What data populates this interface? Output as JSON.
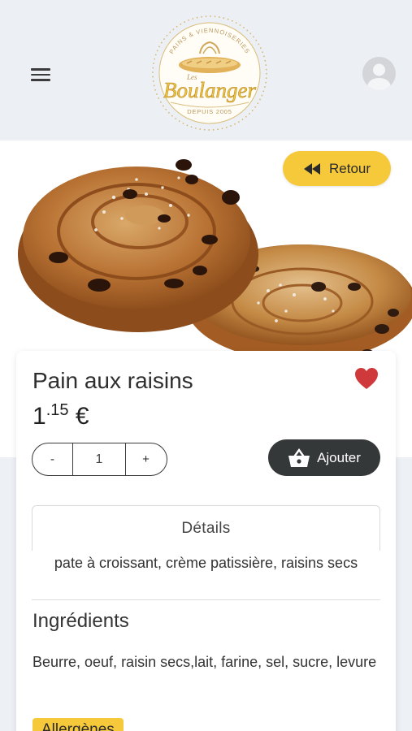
{
  "header": {
    "menu_icon": "hamburger-menu-icon",
    "logo": {
      "arc_text": "PAINS & VIENNOISERIES",
      "small_text": "Les",
      "brand": "Boulanger",
      "since": "DEPUIS 2005"
    },
    "avatar_icon": "user-avatar-icon"
  },
  "hero": {
    "image": "pain-aux-raisins-photo",
    "back_button": {
      "icon": "rewind-icon",
      "label": "Retour"
    }
  },
  "product": {
    "name": "Pain aux raisins",
    "favorite_icon": "heart-icon",
    "favorite_color": "#d0393b",
    "price": {
      "units": "1",
      "cents": ".15",
      "currency": "€"
    },
    "quantity": {
      "minus": "-",
      "value": "1",
      "plus": "+"
    },
    "add_button": {
      "icon": "basket-icon",
      "label": "Ajouter"
    },
    "details_tab": "Détails",
    "details_text": "pate à croissant, crème patissière, raisins secs",
    "ingredients_title": "Ingrédients",
    "ingredients_text": "Beurre, oeuf, raisin secs,lait, farine, sel, sucre, levure",
    "allergens_label": "Allergènes"
  },
  "colors": {
    "accent": "#f5c93a",
    "dark_button": "#353839",
    "header_bg": "#eceff4"
  }
}
